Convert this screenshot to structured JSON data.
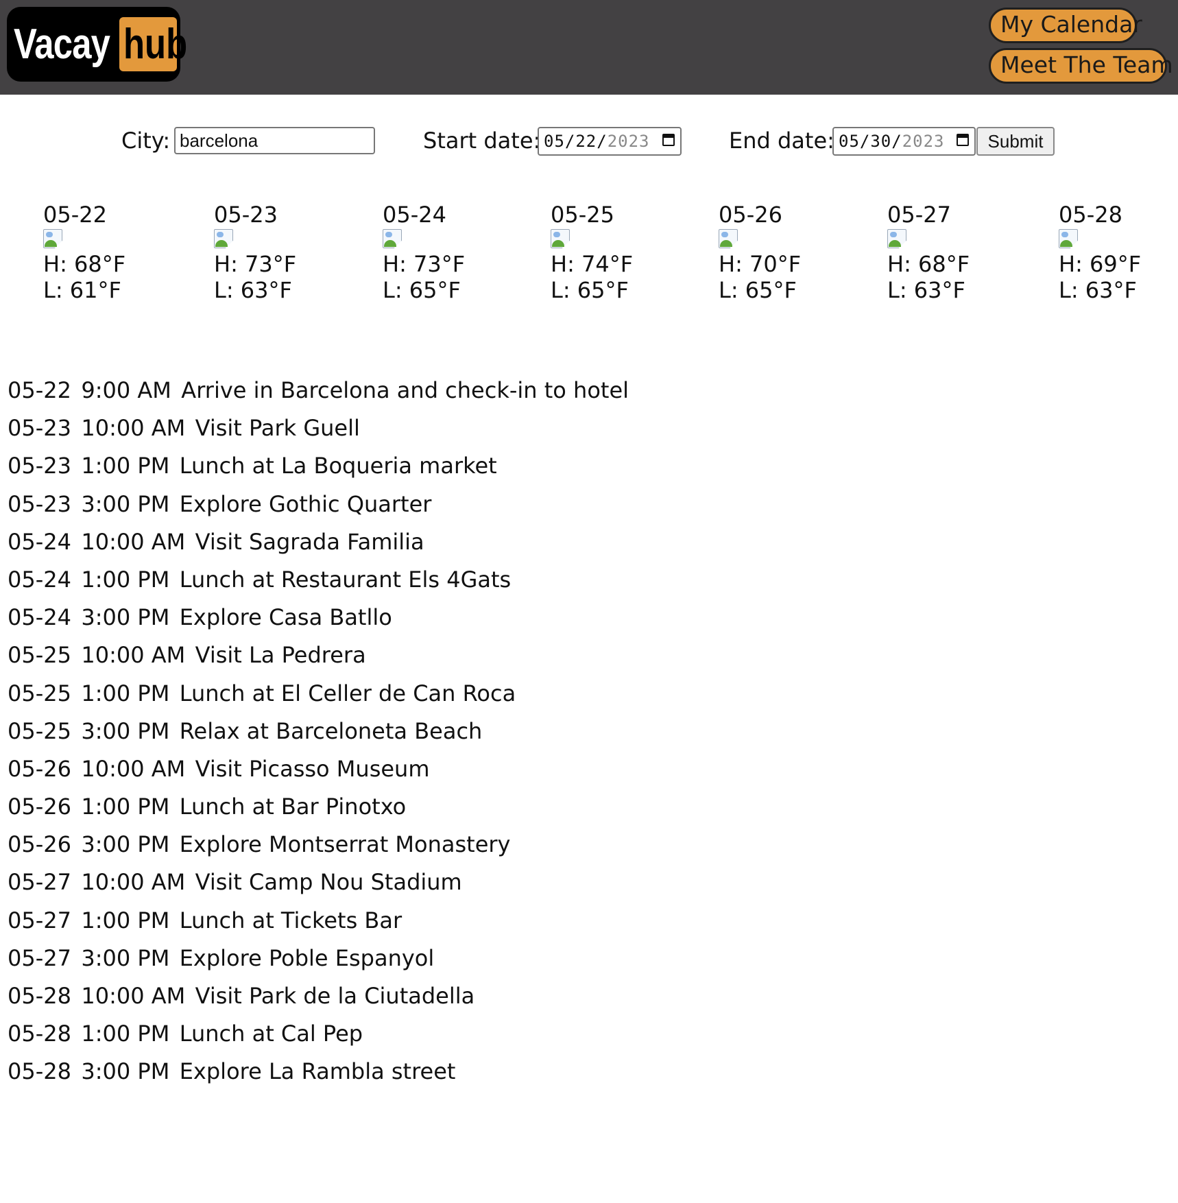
{
  "header": {
    "logo": {
      "part1": "Vacay",
      "part2": "hub"
    },
    "nav": [
      {
        "label": "My Calendar"
      },
      {
        "label": "Meet The Team"
      }
    ]
  },
  "search": {
    "city_label": "City:",
    "city_value": "barcelona",
    "start_label": "Start date:",
    "start_value": {
      "md": "05/22/",
      "year": "2023"
    },
    "end_label": "End date:",
    "end_value": {
      "md": "05/30/",
      "year": "2023"
    },
    "submit_label": "Submit"
  },
  "forecast": [
    {
      "date": "05-22",
      "high": "H: 68°F",
      "low": "L: 61°F"
    },
    {
      "date": "05-23",
      "high": "H: 73°F",
      "low": "L: 63°F"
    },
    {
      "date": "05-24",
      "high": "H: 73°F",
      "low": "L: 65°F"
    },
    {
      "date": "05-25",
      "high": "H: 74°F",
      "low": "L: 65°F"
    },
    {
      "date": "05-26",
      "high": "H: 70°F",
      "low": "L: 65°F"
    },
    {
      "date": "05-27",
      "high": "H: 68°F",
      "low": "L: 63°F"
    },
    {
      "date": "05-28",
      "high": "H: 69°F",
      "low": "L: 63°F"
    }
  ],
  "itinerary": [
    {
      "date": "05-22",
      "time": "9:00 AM",
      "activity": "Arrive in Barcelona and check-in to hotel"
    },
    {
      "date": "05-23",
      "time": "10:00 AM",
      "activity": "Visit Park Guell"
    },
    {
      "date": "05-23",
      "time": "1:00 PM",
      "activity": "Lunch at La Boqueria market"
    },
    {
      "date": "05-23",
      "time": "3:00 PM",
      "activity": "Explore Gothic Quarter"
    },
    {
      "date": "05-24",
      "time": "10:00 AM",
      "activity": "Visit Sagrada Familia"
    },
    {
      "date": "05-24",
      "time": "1:00 PM",
      "activity": "Lunch at Restaurant Els 4Gats"
    },
    {
      "date": "05-24",
      "time": "3:00 PM",
      "activity": "Explore Casa Batllo"
    },
    {
      "date": "05-25",
      "time": "10:00 AM",
      "activity": "Visit La Pedrera"
    },
    {
      "date": "05-25",
      "time": "1:00 PM",
      "activity": "Lunch at El Celler de Can Roca"
    },
    {
      "date": "05-25",
      "time": "3:00 PM",
      "activity": "Relax at Barceloneta Beach"
    },
    {
      "date": "05-26",
      "time": "10:00 AM",
      "activity": "Visit Picasso Museum"
    },
    {
      "date": "05-26",
      "time": "1:00 PM",
      "activity": "Lunch at Bar Pinotxo"
    },
    {
      "date": "05-26",
      "time": "3:00 PM",
      "activity": "Explore Montserrat Monastery"
    },
    {
      "date": "05-27",
      "time": "10:00 AM",
      "activity": "Visit Camp Nou Stadium"
    },
    {
      "date": "05-27",
      "time": "1:00 PM",
      "activity": "Lunch at Tickets Bar"
    },
    {
      "date": "05-27",
      "time": "3:00 PM",
      "activity": "Explore Poble Espanyol"
    },
    {
      "date": "05-28",
      "time": "10:00 AM",
      "activity": "Visit Park de la Ciutadella"
    },
    {
      "date": "05-28",
      "time": "1:00 PM",
      "activity": "Lunch at Cal Pep"
    },
    {
      "date": "05-28",
      "time": "3:00 PM",
      "activity": "Explore La Rambla street"
    }
  ],
  "colors": {
    "header_bg": "#434143",
    "accent": "#e3993c"
  }
}
